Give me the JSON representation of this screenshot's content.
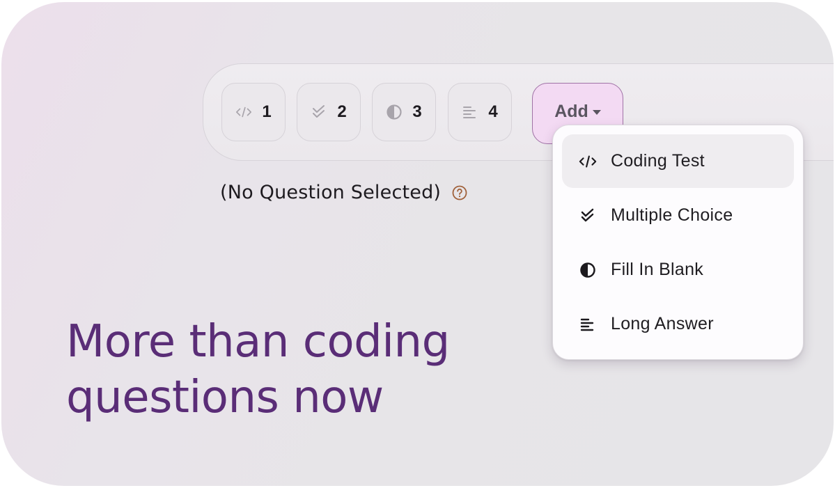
{
  "toolbar": {
    "question_buttons": [
      {
        "icon": "code-icon",
        "number": "1"
      },
      {
        "icon": "double-check-icon",
        "number": "2"
      },
      {
        "icon": "half-circle-icon",
        "number": "3"
      },
      {
        "icon": "align-left-icon",
        "number": "4"
      }
    ],
    "add_label": "Add"
  },
  "status": {
    "text": "(No Question Selected)",
    "help_icon": "question-circle-icon"
  },
  "headline": {
    "line1": "More than coding",
    "line2": "questions now"
  },
  "menu": {
    "items": [
      {
        "icon": "code-icon",
        "label": "Coding Test",
        "active": true
      },
      {
        "icon": "double-check-icon",
        "label": "Multiple Choice",
        "active": false
      },
      {
        "icon": "half-circle-icon",
        "label": "Fill In Blank",
        "active": false
      },
      {
        "icon": "align-left-icon",
        "label": "Long Answer",
        "active": false
      }
    ]
  },
  "colors": {
    "headline": "#5a2d77",
    "add_button_bg": "#f3daf3",
    "add_button_border": "#a072a6",
    "help_icon": "#a0613a"
  }
}
